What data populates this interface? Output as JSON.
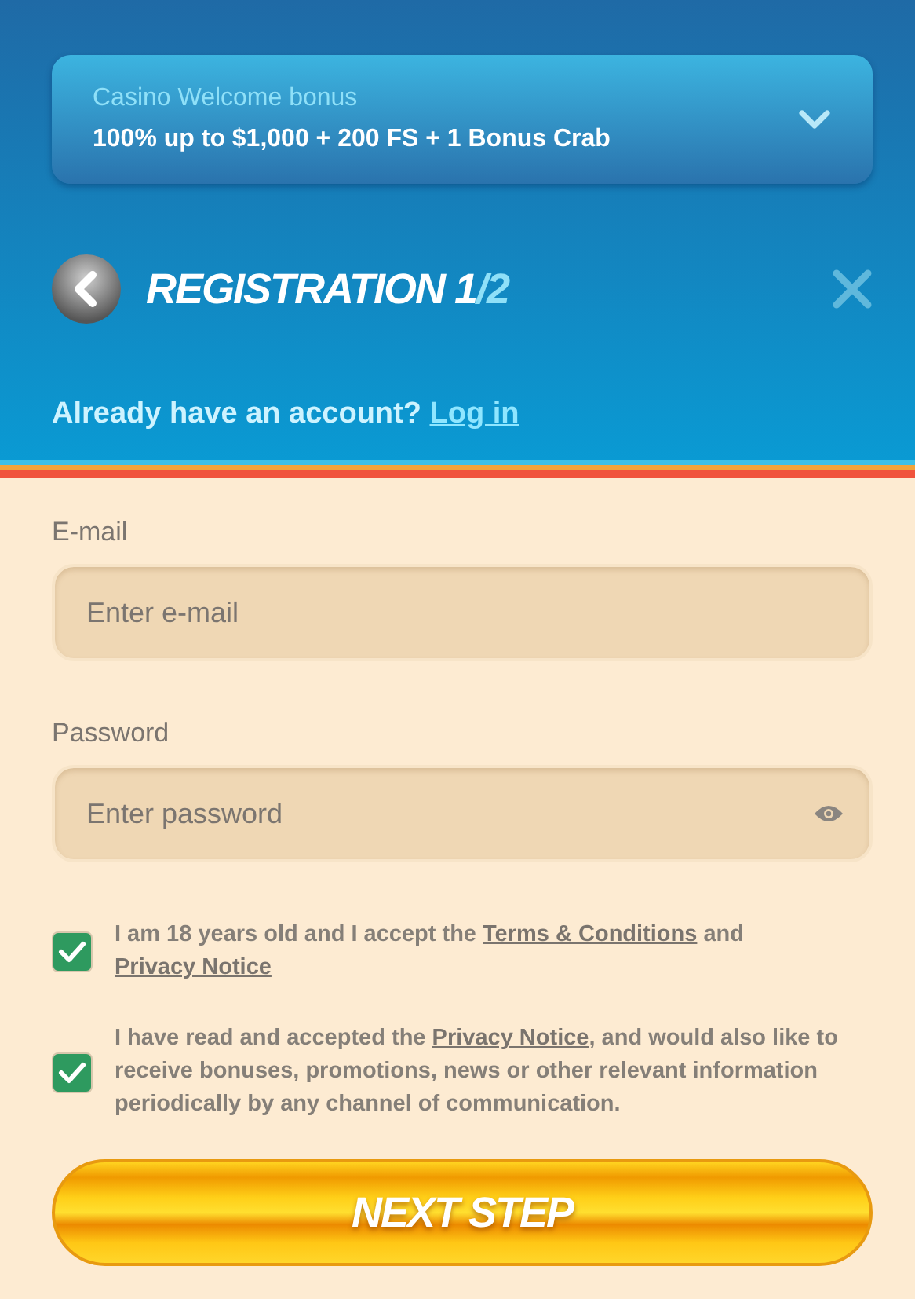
{
  "bonus": {
    "label": "Casino Welcome bonus",
    "offer": "100% up to $1,000 + 200 FS + 1 Bonus Crab",
    "expanded": false
  },
  "header": {
    "title": "REGISTRATION 1",
    "title_suffix": "/2"
  },
  "login_prompt": {
    "text": "Already have an account?",
    "link": "Log in"
  },
  "fields": [
    {
      "label": "E-mail",
      "placeholder": "Enter e-mail",
      "kind": "email"
    },
    {
      "label": "Password",
      "placeholder": "Enter password",
      "kind": "password"
    }
  ],
  "consents": [
    {
      "checked": true,
      "parts": [
        {
          "kind": "text",
          "text": "I am 18 years old and I accept the "
        },
        {
          "kind": "link",
          "text": "Terms & Conditions"
        },
        {
          "kind": "text",
          "text": " and "
        },
        {
          "kind": "link",
          "text": "Privacy Notice"
        }
      ]
    },
    {
      "checked": true,
      "parts": [
        {
          "kind": "text",
          "text": "I have read and accepted the "
        },
        {
          "kind": "link",
          "text": "Privacy Notice"
        },
        {
          "kind": "text",
          "text": ", and would also like to receive bonuses, promotions, news or other relevant information periodically by any channel of communication."
        }
      ]
    }
  ],
  "next_button": "NEXT STEP"
}
